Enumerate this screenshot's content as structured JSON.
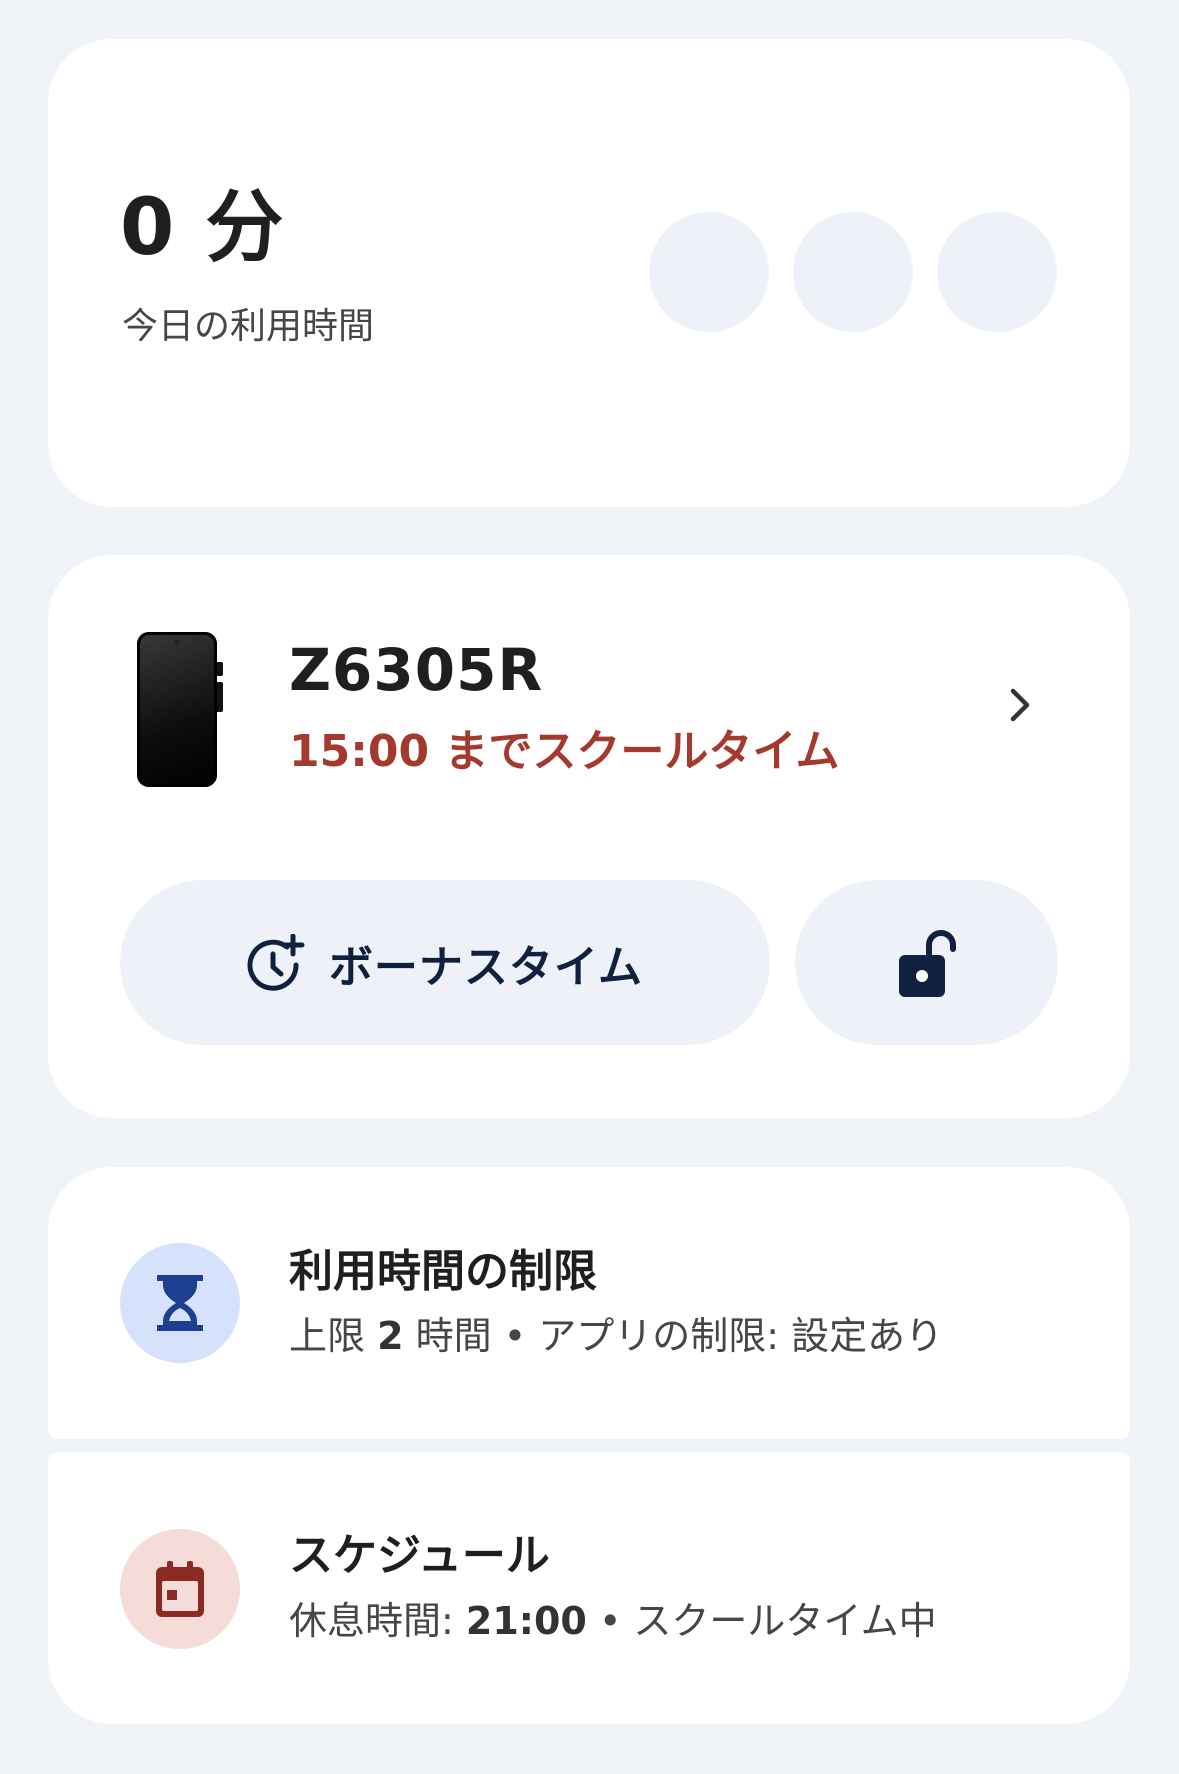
{
  "usage": {
    "value": "0 分",
    "label": "今日の利用時間",
    "app_slots": 3
  },
  "device": {
    "name": "Z6305R",
    "status": "15:00 までスクールタイム",
    "status_color": "#a33a2d",
    "bonus_label": "ボーナスタイム"
  },
  "limits": {
    "title": "利用時間の制限",
    "subtitle_prefix": "上限 ",
    "subtitle_value": "2",
    "subtitle_suffix": " 時間 • アプリの制限: 設定あり",
    "icon": "hourglass-icon",
    "icon_color": "#1e3f8f",
    "icon_bg": "#d6e2fb"
  },
  "schedule": {
    "title": "スケジュール",
    "subtitle_prefix": "休息時間: ",
    "subtitle_value": "21:00",
    "subtitle_suffix": " • スクールタイム中",
    "icon": "calendar-icon",
    "icon_color": "#8a2a22",
    "icon_bg": "#f5dcd9"
  }
}
